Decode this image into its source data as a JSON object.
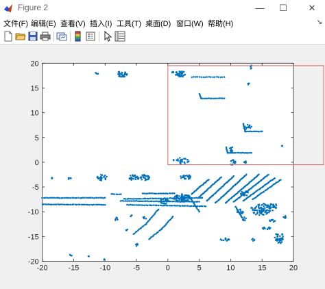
{
  "window": {
    "title": "Figure 2",
    "minimize_glyph": "—",
    "maximize_glyph": "☐",
    "close_glyph": "✕"
  },
  "menu": [
    {
      "label": "文件(F)"
    },
    {
      "label": "编辑(E)"
    },
    {
      "label": "查看(V)"
    },
    {
      "label": "插入(I)"
    },
    {
      "label": "工具(T)"
    },
    {
      "label": "桌面(D)"
    },
    {
      "label": "窗口(W)"
    },
    {
      "label": "帮助(H)"
    }
  ],
  "toolbar": [
    {
      "icon": "new-figure-icon"
    },
    {
      "icon": "open-file-icon"
    },
    {
      "icon": "save-icon"
    },
    {
      "icon": "print-icon"
    },
    {
      "icon": "link-figure-icon"
    },
    {
      "icon": "insert-colorbar-icon"
    },
    {
      "icon": "insert-legend-icon"
    },
    {
      "icon": "edit-plot-icon"
    },
    {
      "icon": "property-inspector-icon"
    }
  ],
  "colors": {
    "marker": "#0072bd",
    "zoom_box": "#e06060",
    "figure_bg": "#f0f0f0",
    "axes_bg": "#ffffff"
  },
  "chart_data": {
    "type": "scatter",
    "xlim": [
      -20,
      20
    ],
    "ylim": [
      -20,
      20
    ],
    "xticks": [
      -20,
      -15,
      -10,
      -5,
      0,
      5,
      10,
      15,
      20
    ],
    "yticks": [
      -20,
      -15,
      -10,
      -5,
      0,
      5,
      10,
      15,
      20
    ],
    "grid": false,
    "zoom_rectangle": {
      "x": [
        0,
        25
      ],
      "y": [
        -0.5,
        19.5
      ]
    },
    "clusters": [
      {
        "cx": -7.3,
        "cy": 17.8,
        "rx": 0.9,
        "ry": 0.6,
        "n": 34
      },
      {
        "cx": 2.1,
        "cy": 17.8,
        "rx": 1.1,
        "ry": 0.6,
        "n": 36
      },
      {
        "cx": -11.4,
        "cy": 17.9,
        "rx": 0.3,
        "ry": 0.2,
        "n": 4
      },
      {
        "cx": 0.8,
        "cy": 18.1,
        "rx": 0.2,
        "ry": 0.2,
        "n": 4
      },
      {
        "cx": 13.2,
        "cy": 19.2,
        "rx": 0.2,
        "ry": 0.5,
        "n": 6
      },
      {
        "cx": 12.8,
        "cy": 15.8,
        "rx": 0.2,
        "ry": 0.2,
        "n": 3
      },
      {
        "cx": 12.8,
        "cy": 7.1,
        "rx": 0.6,
        "ry": 0.5,
        "n": 14
      },
      {
        "cx": 10.1,
        "cy": 2.6,
        "rx": 0.3,
        "ry": 0.5,
        "n": 10
      },
      {
        "cx": 18.2,
        "cy": 3.4,
        "rx": 0.1,
        "ry": 0.2,
        "n": 3
      },
      {
        "cx": 2.1,
        "cy": 0.3,
        "rx": 1.3,
        "ry": 0.6,
        "n": 30
      },
      {
        "cx": 10.3,
        "cy": 0.0,
        "rx": 0.5,
        "ry": 0.6,
        "n": 14
      },
      {
        "cx": 12.3,
        "cy": 0.0,
        "rx": 0.2,
        "ry": 0.3,
        "n": 5
      },
      {
        "cx": -10.5,
        "cy": -3.1,
        "rx": 0.8,
        "ry": 0.6,
        "n": 28
      },
      {
        "cx": -5.4,
        "cy": -3.1,
        "rx": 0.8,
        "ry": 0.6,
        "n": 28
      },
      {
        "cx": -3.7,
        "cy": -3.1,
        "rx": 0.8,
        "ry": 0.6,
        "n": 30
      },
      {
        "cx": 2.9,
        "cy": -3.0,
        "rx": 0.9,
        "ry": 0.5,
        "n": 28
      },
      {
        "cx": -18.5,
        "cy": -3.3,
        "rx": 0.1,
        "ry": 0.2,
        "n": 3
      },
      {
        "cx": -15.7,
        "cy": -3.3,
        "rx": 0.3,
        "ry": 0.2,
        "n": 5
      },
      {
        "cx": 2.3,
        "cy": -7.2,
        "rx": 1.4,
        "ry": 0.8,
        "n": 70
      },
      {
        "cx": -0.5,
        "cy": -7.9,
        "rx": 0.8,
        "ry": 0.5,
        "n": 25
      },
      {
        "cx": 14.8,
        "cy": -9.5,
        "rx": 1.6,
        "ry": 1.2,
        "n": 80
      },
      {
        "cx": 16.8,
        "cy": -9.0,
        "rx": 0.6,
        "ry": 0.8,
        "n": 18
      },
      {
        "cx": 11.5,
        "cy": -10.0,
        "rx": 0.5,
        "ry": 0.5,
        "n": 12
      },
      {
        "cx": 12.3,
        "cy": -6.3,
        "rx": 0.7,
        "ry": 0.5,
        "n": 16
      },
      {
        "cx": 12.2,
        "cy": -11.5,
        "rx": 0.3,
        "ry": 0.4,
        "n": 8
      },
      {
        "cx": 9.2,
        "cy": -15.6,
        "rx": 0.8,
        "ry": 0.3,
        "n": 16
      },
      {
        "cx": 17.7,
        "cy": -15.2,
        "rx": 0.7,
        "ry": 1.3,
        "n": 40
      },
      {
        "cx": 15.6,
        "cy": -13.3,
        "rx": 0.8,
        "ry": 0.3,
        "n": 12
      },
      {
        "cx": 16.7,
        "cy": -11.8,
        "rx": 0.5,
        "ry": 0.3,
        "n": 8
      },
      {
        "cx": 13.5,
        "cy": -15.7,
        "rx": 0.3,
        "ry": 0.3,
        "n": 5
      },
      {
        "cx": 18.5,
        "cy": -11.0,
        "rx": 0.3,
        "ry": 0.4,
        "n": 6
      },
      {
        "cx": -8.2,
        "cy": -11.5,
        "rx": 0.2,
        "ry": 0.4,
        "n": 5
      },
      {
        "cx": -4.9,
        "cy": -16.7,
        "rx": 0.3,
        "ry": 0.3,
        "n": 5
      },
      {
        "cx": -3.7,
        "cy": -11.2,
        "rx": 0.3,
        "ry": 0.3,
        "n": 5
      },
      {
        "cx": -15.5,
        "cy": -18.8,
        "rx": 0.2,
        "ry": 0.2,
        "n": 3
      },
      {
        "cx": -5.8,
        "cy": -11.0,
        "rx": 0.2,
        "ry": 0.3,
        "n": 4
      },
      {
        "cx": -10.2,
        "cy": -19.6,
        "rx": 0.1,
        "ry": 0.2,
        "n": 3
      },
      {
        "cx": -6.6,
        "cy": -13.6,
        "rx": 0.2,
        "ry": 0.2,
        "n": 3
      },
      {
        "cx": -12.6,
        "cy": -19.0,
        "rx": 0.1,
        "ry": 0.1,
        "n": 2
      }
    ],
    "polylines": [
      {
        "pts": [
          [
            3.8,
            17.2
          ],
          [
            9.0,
            17.2
          ]
        ],
        "spacing": 0.3
      },
      {
        "pts": [
          [
            5.0,
            13.8
          ],
          [
            5.3,
            12.9
          ],
          [
            9.0,
            12.9
          ]
        ],
        "spacing": 0.25
      },
      {
        "pts": [
          [
            12.0,
            7.8
          ],
          [
            12.3,
            6.2
          ],
          [
            15.0,
            6.2
          ]
        ],
        "spacing": 0.22
      },
      {
        "pts": [
          [
            9.3,
            3.0
          ],
          [
            9.5,
            1.9
          ],
          [
            13.3,
            1.9
          ]
        ],
        "spacing": 0.22
      },
      {
        "pts": [
          [
            -20.0,
            -7.2
          ],
          [
            -10.0,
            -7.2
          ]
        ],
        "spacing": 0.25
      },
      {
        "pts": [
          [
            -20.0,
            -8.5
          ],
          [
            -10.0,
            -8.6
          ]
        ],
        "spacing": 0.25
      },
      {
        "pts": [
          [
            -9.0,
            -6.4
          ],
          [
            -7.5,
            -6.5
          ]
        ],
        "spacing": 0.25
      },
      {
        "pts": [
          [
            -7.0,
            -7.4
          ],
          [
            5.5,
            -7.2
          ]
        ],
        "spacing": 0.25
      },
      {
        "pts": [
          [
            -7.5,
            -7.8
          ],
          [
            5.0,
            -8.0
          ]
        ],
        "spacing": 0.25
      },
      {
        "pts": [
          [
            -6.5,
            -8.6
          ],
          [
            6.0,
            -8.9
          ]
        ],
        "spacing": 0.25
      },
      {
        "pts": [
          [
            -4.0,
            -6.3
          ],
          [
            1.0,
            -6.3
          ]
        ],
        "spacing": 0.25
      },
      {
        "pts": [
          [
            5.0,
            -10.0
          ],
          [
            3.5,
            -7.0
          ]
        ],
        "spacing": 0.25
      },
      {
        "pts": [
          [
            3.8,
            -6.4
          ],
          [
            6.5,
            -3.5
          ]
        ],
        "spacing": 0.2
      },
      {
        "pts": [
          [
            5.0,
            -7.0
          ],
          [
            8.5,
            -3.0
          ]
        ],
        "spacing": 0.2
      },
      {
        "pts": [
          [
            6.2,
            -7.8
          ],
          [
            10.5,
            -2.8
          ]
        ],
        "spacing": 0.2
      },
      {
        "pts": [
          [
            7.6,
            -8.2
          ],
          [
            12.5,
            -2.5
          ]
        ],
        "spacing": 0.2
      },
      {
        "pts": [
          [
            9.2,
            -8.2
          ],
          [
            14.5,
            -2.5
          ]
        ],
        "spacing": 0.2
      },
      {
        "pts": [
          [
            10.5,
            -8.0
          ],
          [
            16.0,
            -2.5
          ]
        ],
        "spacing": 0.2
      },
      {
        "pts": [
          [
            12.0,
            -7.8
          ],
          [
            17.0,
            -3.2
          ]
        ],
        "spacing": 0.2
      },
      {
        "pts": [
          [
            13.5,
            -7.5
          ],
          [
            18.0,
            -3.5
          ]
        ],
        "spacing": 0.22
      },
      {
        "pts": [
          [
            -1.5,
            -9.5
          ],
          [
            -3.5,
            -12.5
          ],
          [
            -5.5,
            -14.5
          ]
        ],
        "spacing": 0.25
      },
      {
        "pts": [
          [
            0.8,
            -11.0
          ],
          [
            -1.0,
            -13.5
          ],
          [
            -3.0,
            -15.5
          ]
        ],
        "spacing": 0.25
      },
      {
        "pts": [
          [
            10.8,
            -9.0
          ],
          [
            11.8,
            -11.2
          ]
        ],
        "spacing": 0.2
      }
    ]
  }
}
